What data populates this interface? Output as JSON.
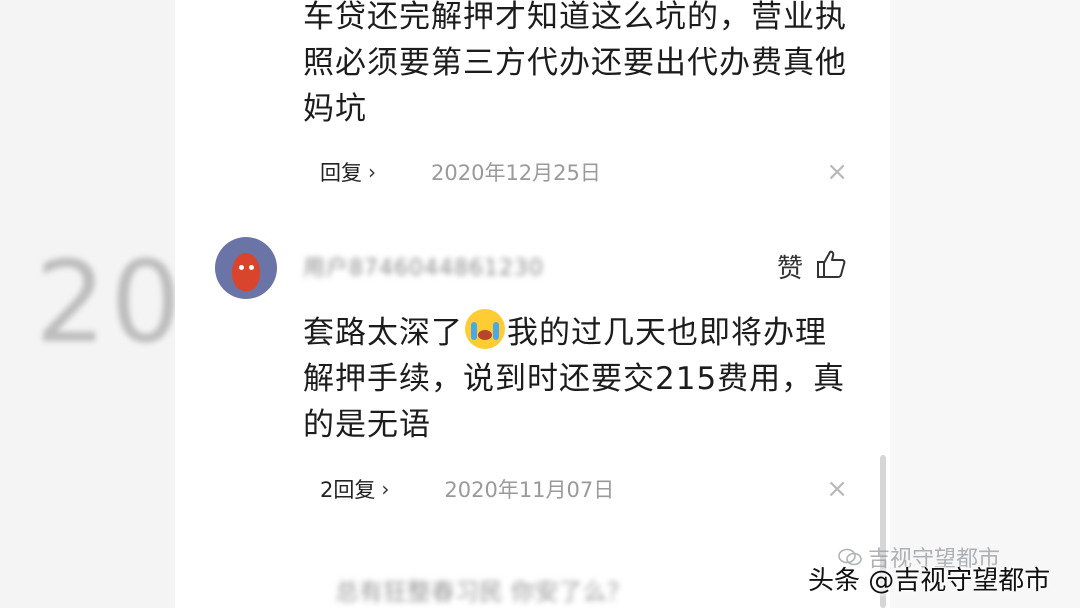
{
  "background": {
    "left_number": "20"
  },
  "comment1": {
    "text_lines": [
      "车贷还完解押才知道这么坑的，营业执",
      "照必须要第三方代办还要出代办费真他",
      "妈坑"
    ],
    "reply_label": "回复",
    "date": "2020年12月25日",
    "close_glyph": "×"
  },
  "comment2": {
    "username": "用户8746044861230",
    "like_label": "赞",
    "text_line1_before_emoji": "套路太深了",
    "emoji": "crying-face",
    "text_line1_after_emoji": "我的过几天也即将办理",
    "text_line2": "解押手续，说到时还要交215费用，真",
    "text_line3": "的是无语",
    "reply_label": "2回复",
    "date": "2020年11月07日",
    "close_glyph": "×"
  },
  "next_comment": {
    "text": "总有狂整春习民 你安了么？"
  },
  "watermark": {
    "top_text": "吉视守望都市",
    "main_text": "头条 @吉视守望都市"
  },
  "colors": {
    "avatar_bg": "#6a74a6",
    "meta_date": "#9a9a9a",
    "close": "#b8b8b8"
  }
}
